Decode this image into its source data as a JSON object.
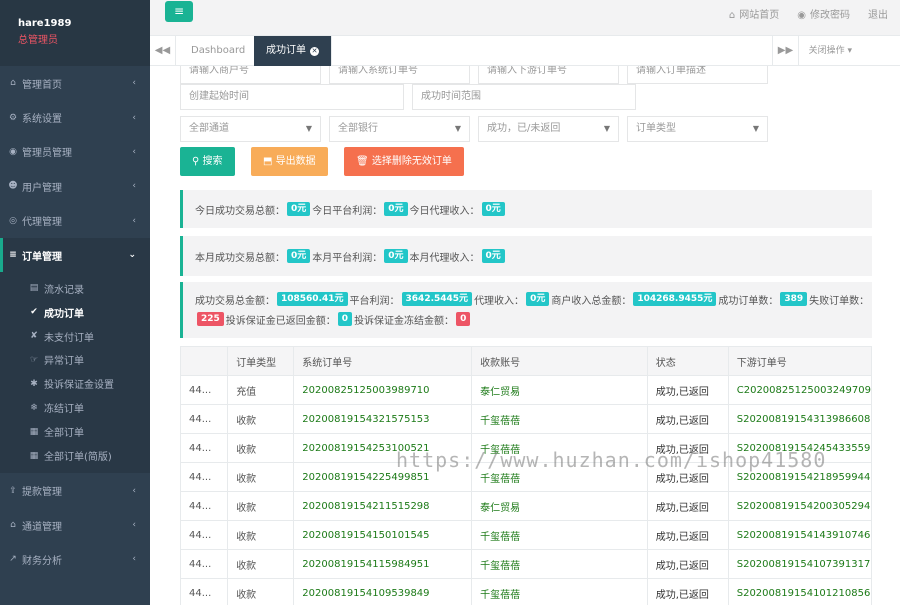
{
  "profile": {
    "username": "hare1989",
    "role": "总管理员"
  },
  "sidebar": {
    "items": [
      {
        "icon": "home-icon",
        "glyph": "⌂",
        "label": "管理首页"
      },
      {
        "icon": "cogs-icon",
        "glyph": "⚙",
        "label": "系统设置"
      },
      {
        "icon": "user-icon",
        "glyph": "◉",
        "label": "管理员管理"
      },
      {
        "icon": "users-icon",
        "glyph": "☻",
        "label": "用户管理"
      },
      {
        "icon": "eye-icon",
        "glyph": "◎",
        "label": "代理管理"
      },
      {
        "icon": "list-icon",
        "glyph": "≡",
        "label": "订单管理"
      }
    ],
    "submenu": [
      {
        "icon": "list-alt-icon",
        "glyph": "▤",
        "label": "流水记录"
      },
      {
        "icon": "thumbs-up-icon",
        "glyph": "✔",
        "label": "成功订单"
      },
      {
        "icon": "thumbs-down-icon",
        "glyph": "✘",
        "label": "未支付订单"
      },
      {
        "icon": "hand-icon",
        "glyph": "☞",
        "label": "异常订单"
      },
      {
        "icon": "asterisk-icon",
        "glyph": "✱",
        "label": "投诉保证金设置"
      },
      {
        "icon": "snowflake-icon",
        "glyph": "❄",
        "label": "冻结订单"
      },
      {
        "icon": "th-icon",
        "glyph": "▦",
        "label": "全部订单"
      },
      {
        "icon": "th-icon",
        "glyph": "▦",
        "label": "全部订单(简版)"
      }
    ],
    "bottom_items": [
      {
        "icon": "withdraw-icon",
        "glyph": "⇪",
        "label": "提款管理"
      },
      {
        "icon": "bank-icon",
        "glyph": "⌂",
        "label": "通道管理"
      },
      {
        "icon": "chart-icon",
        "glyph": "↗",
        "label": "财务分析"
      }
    ]
  },
  "topbar": {
    "menu_glyph": "≡",
    "home_link": "网站首页",
    "password_link": "修改密码",
    "logout": "退出"
  },
  "tabs": {
    "prev": "◀◀",
    "next": "▶▶",
    "dashboard": "Dashboard",
    "active": "成功订单",
    "close_ops": "关闭操作"
  },
  "filters": {
    "row0": [
      "请输入商户号",
      "请输入系统订单号",
      "请输入下游订单号",
      "请输入订单描述"
    ],
    "start_time": "创建起始时间",
    "success_range": "成功时间范围",
    "channel": "全部通道",
    "bank": "全部银行",
    "status": "成功，已/未返回",
    "order_type": "订单类型"
  },
  "buttons": {
    "search": "搜索",
    "export": "导出数据",
    "delete": "选择删除无效订单"
  },
  "stats": {
    "today": {
      "label1": "今日成功交易总额：",
      "v1": "0元",
      "label2": "今日平台利润：",
      "v2": "0元",
      "label3": "今日代理收入：",
      "v3": "0元"
    },
    "month": {
      "label1": "本月成功交易总额：",
      "v1": "0元",
      "label2": "本月平台利润：",
      "v2": "0元",
      "label3": "本月代理收入：",
      "v3": "0元"
    },
    "total": {
      "l1": "成功交易总金额：",
      "v1": "108560.41元",
      "l2": "平台利润：",
      "v2": "3642.5445元",
      "l3": "代理收入：",
      "v3": "0元",
      "l4": "商户收入总金额：",
      "v4": "104268.9455元",
      "l5": "成功订单数：",
      "v5": "389",
      "l6": "失败订单数：",
      "v6": "225",
      "l7": "投诉保证金已返回金额：",
      "v7": "0",
      "l8": "投诉保证金冻结金额：",
      "v8": "0"
    }
  },
  "table": {
    "headers": [
      "",
      "订单类型",
      "系统订单号",
      "收款账号",
      "状态",
      "下游订单号"
    ],
    "rows": [
      [
        "44...",
        "充值",
        "20200825125003989710",
        "泰仁贸易",
        "成功,已返回",
        "C20200825125003249709"
      ],
      [
        "44...",
        "收款",
        "20200819154321575153",
        "千玺蓓蓓",
        "成功,已返回",
        "S20200819154313986608"
      ],
      [
        "44...",
        "收款",
        "20200819154253100521",
        "千玺蓓蓓",
        "成功,已返回",
        "S20200819154245433559"
      ],
      [
        "44...",
        "收款",
        "20200819154225499851",
        "千玺蓓蓓",
        "成功,已返回",
        "S20200819154218959944"
      ],
      [
        "44...",
        "收款",
        "20200819154211515298",
        "泰仁贸易",
        "成功,已返回",
        "S20200819154200305294"
      ],
      [
        "44...",
        "收款",
        "20200819154150101545",
        "千玺蓓蓓",
        "成功,已返回",
        "S20200819154143910746"
      ],
      [
        "44...",
        "收款",
        "20200819154115984951",
        "千玺蓓蓓",
        "成功,已返回",
        "S20200819154107391317"
      ],
      [
        "44...",
        "收款",
        "20200819154109539849",
        "千玺蓓蓓",
        "成功,已返回",
        "S20200819154101210856"
      ]
    ]
  },
  "watermark": "https://www.huzhan.com/ishop41580"
}
